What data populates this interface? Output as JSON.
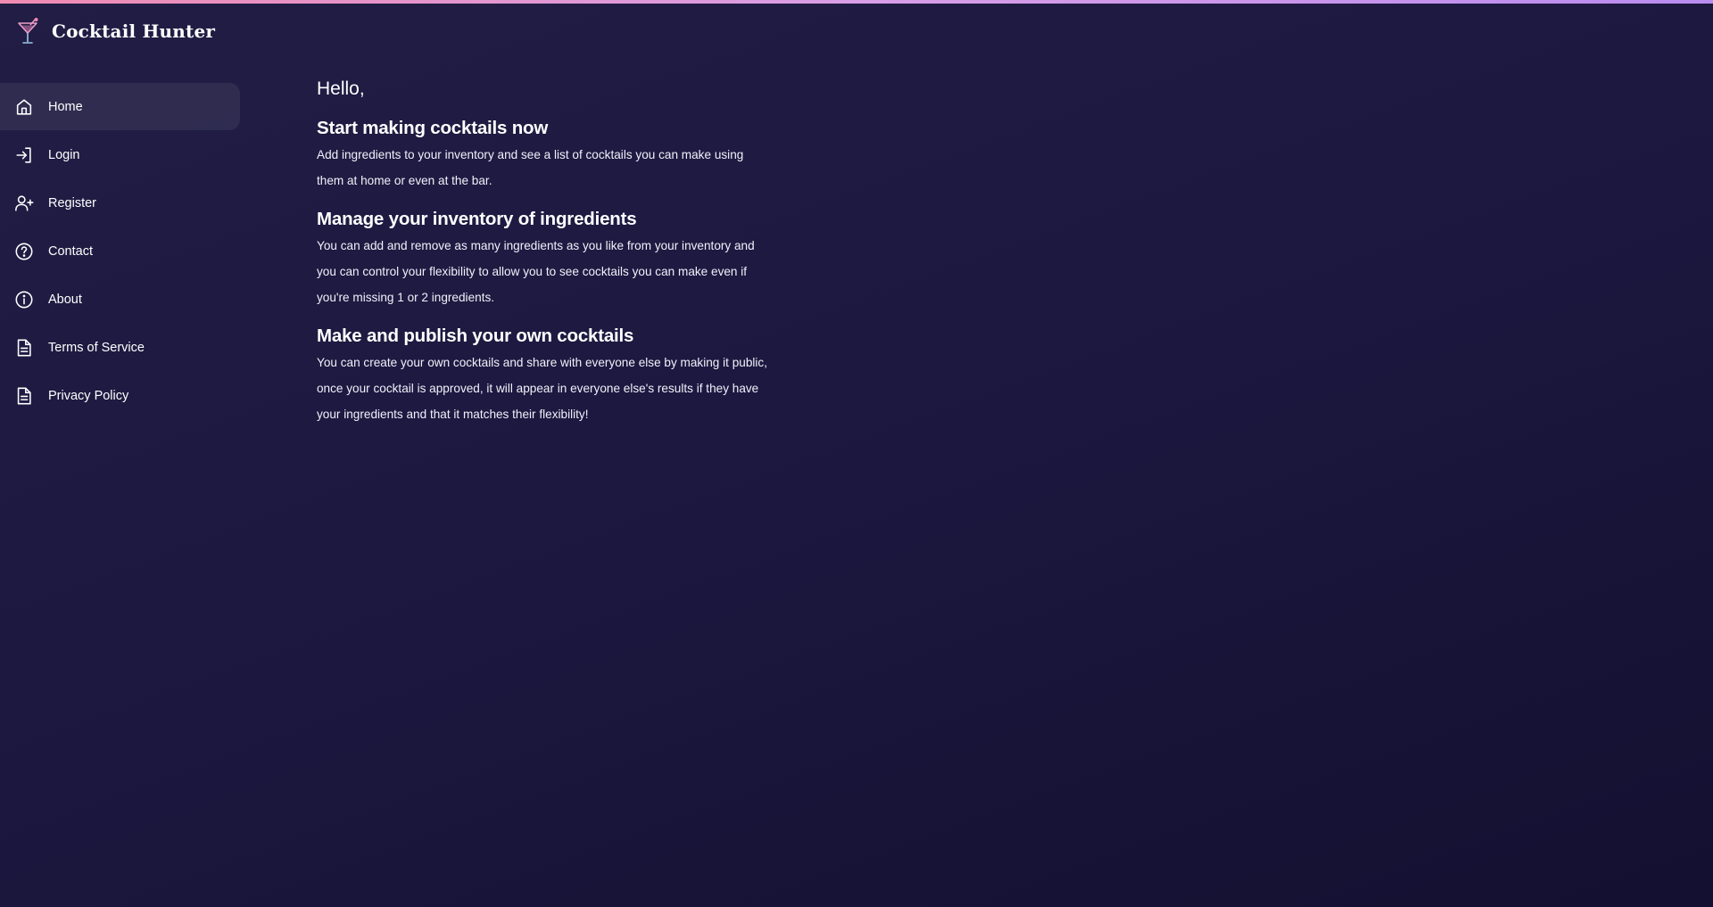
{
  "app": {
    "name": "Cocktail Hunter",
    "logo_icon": "cocktail-glass-icon",
    "accent_colors": [
      "#f08bb2",
      "#b98cf0"
    ]
  },
  "sidebar": {
    "items": [
      {
        "label": "Home",
        "icon": "home-icon",
        "active": true
      },
      {
        "label": "Login",
        "icon": "login-icon",
        "active": false
      },
      {
        "label": "Register",
        "icon": "add-user-icon",
        "active": false
      },
      {
        "label": "Contact",
        "icon": "help-circle-icon",
        "active": false
      },
      {
        "label": "About",
        "icon": "info-icon",
        "active": false
      },
      {
        "label": "Terms of Service",
        "icon": "document-icon",
        "active": false
      },
      {
        "label": "Privacy Policy",
        "icon": "document-icon",
        "active": false
      }
    ]
  },
  "main": {
    "greeting": "Hello,",
    "sections": [
      {
        "title": "Start making cocktails now",
        "body": "Add ingredients to your inventory and see a list of cocktails you can make using them at home or even at the bar."
      },
      {
        "title": "Manage your inventory of ingredients",
        "body": "You can add and remove as many ingredients as you like from your inventory and you can control your flexibility to allow you to see cocktails you can make even if you're missing 1 or 2 ingredients."
      },
      {
        "title": "Make and publish your own cocktails",
        "body": "You can create your own cocktails and share with everyone else by making it public, once your cocktail is approved, it will appear in everyone else's results if they have your ingredients and that it matches their flexibility!"
      }
    ]
  }
}
